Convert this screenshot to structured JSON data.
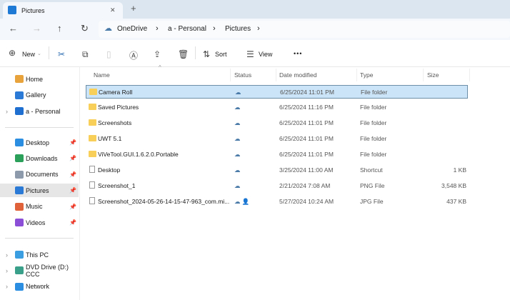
{
  "window": {
    "tab_title": "Pictures",
    "close": "✕",
    "new_tab": "+"
  },
  "nav": {
    "back": "←",
    "forward": "→",
    "up": "↑",
    "refresh": "↻",
    "breadcrumb": [
      "OneDrive",
      "a - Personal",
      "Pictures"
    ],
    "sep": "›"
  },
  "toolbar": {
    "new_label": "New",
    "sort_label": "Sort",
    "view_label": "View",
    "more": "•••"
  },
  "sidebar": {
    "items": [
      {
        "label": "Home",
        "color": "#e8a33c"
      },
      {
        "label": "Gallery",
        "color": "#2b7bd6"
      },
      {
        "label": "a - Personal",
        "color": "#1f6fd1",
        "chevron": true
      }
    ],
    "pinned": [
      {
        "label": "Desktop",
        "color": "#2b8ee0"
      },
      {
        "label": "Downloads",
        "color": "#2aa05a"
      },
      {
        "label": "Documents",
        "color": "#8c9aab"
      },
      {
        "label": "Pictures",
        "color": "#2b7bd6",
        "selected": true
      },
      {
        "label": "Music",
        "color": "#e0623a"
      },
      {
        "label": "Videos",
        "color": "#8a4fd6"
      }
    ],
    "devices": [
      {
        "label": "This PC",
        "color": "#3a9ee0"
      },
      {
        "label": "DVD Drive (D:) CCC",
        "color": "#3aa08a"
      },
      {
        "label": "Network",
        "color": "#2b8ee0"
      }
    ]
  },
  "columns": {
    "name": "Name",
    "status": "Status",
    "date": "Date modified",
    "type": "Type",
    "size": "Size"
  },
  "files": [
    {
      "name": "Camera Roll",
      "status": "☁",
      "date": "6/25/2024 11:01 PM",
      "type": "File folder",
      "size": "",
      "kind": "folder",
      "selected": true
    },
    {
      "name": "Saved Pictures",
      "status": "☁",
      "date": "6/25/2024 11:16 PM",
      "type": "File folder",
      "size": "",
      "kind": "folder"
    },
    {
      "name": "Screenshots",
      "status": "☁",
      "date": "6/25/2024 11:01 PM",
      "type": "File folder",
      "size": "",
      "kind": "folder"
    },
    {
      "name": "UWT 5.1",
      "status": "☁",
      "date": "6/25/2024 11:01 PM",
      "type": "File folder",
      "size": "",
      "kind": "folder"
    },
    {
      "name": "ViVeTool.GUI.1.6.2.0.Portable",
      "status": "☁",
      "date": "6/25/2024 11:01 PM",
      "type": "File folder",
      "size": "",
      "kind": "folder"
    },
    {
      "name": "Desktop",
      "status": "☁",
      "date": "3/25/2024 11:00 AM",
      "type": "Shortcut",
      "size": "1 KB",
      "kind": "file"
    },
    {
      "name": "Screenshot_1",
      "status": "☁",
      "date": "2/21/2024 7:08 AM",
      "type": "PNG File",
      "size": "3,548 KB",
      "kind": "file"
    },
    {
      "name": "Screenshot_2024-05-26-14-15-47-963_com.mi...",
      "status": "☁ 👤",
      "date": "5/27/2024 10:24 AM",
      "type": "JPG File",
      "size": "437 KB",
      "kind": "file"
    }
  ]
}
